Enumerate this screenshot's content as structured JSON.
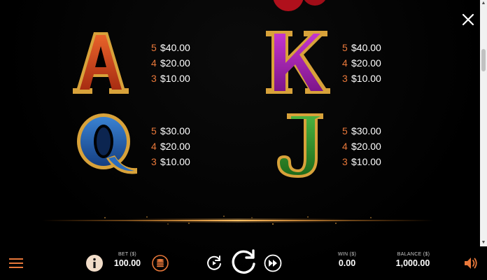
{
  "paytable": {
    "symbols": [
      {
        "symbol": "A",
        "icon": "letter-a-symbol-icon",
        "color": "#c8421e",
        "payouts": [
          {
            "count": "5",
            "amount": "$40.00"
          },
          {
            "count": "4",
            "amount": "$20.00"
          },
          {
            "count": "3",
            "amount": "$10.00"
          }
        ]
      },
      {
        "symbol": "K",
        "icon": "letter-k-symbol-icon",
        "color": "#a520b0",
        "payouts": [
          {
            "count": "5",
            "amount": "$40.00"
          },
          {
            "count": "4",
            "amount": "$20.00"
          },
          {
            "count": "3",
            "amount": "$10.00"
          }
        ]
      },
      {
        "symbol": "Q",
        "icon": "letter-q-symbol-icon",
        "color": "#1f5ba8",
        "payouts": [
          {
            "count": "5",
            "amount": "$30.00"
          },
          {
            "count": "4",
            "amount": "$20.00"
          },
          {
            "count": "3",
            "amount": "$10.00"
          }
        ]
      },
      {
        "symbol": "J",
        "icon": "letter-j-symbol-icon",
        "color": "#2e8a2a",
        "payouts": [
          {
            "count": "5",
            "amount": "$30.00"
          },
          {
            "count": "4",
            "amount": "$20.00"
          },
          {
            "count": "3",
            "amount": "$10.00"
          }
        ]
      }
    ]
  },
  "bottom_bar": {
    "bet_label": "BET ($)",
    "bet_value": "100.00",
    "win_label": "WIN ($)",
    "win_value": "0.00",
    "balance_label": "BALANCE ($)",
    "balance_value": "1,000.00"
  },
  "icons": {
    "menu": "hamburger-menu-icon",
    "info": "info-icon",
    "coins": "coin-stack-icon",
    "autoplay": "autoplay-icon",
    "spin": "spin-icon",
    "turbo": "fast-forward-icon",
    "sound": "speaker-icon",
    "close": "close-icon"
  },
  "colors": {
    "accent": "#e9783a",
    "background": "#000000",
    "gold": "#d8a23a"
  }
}
